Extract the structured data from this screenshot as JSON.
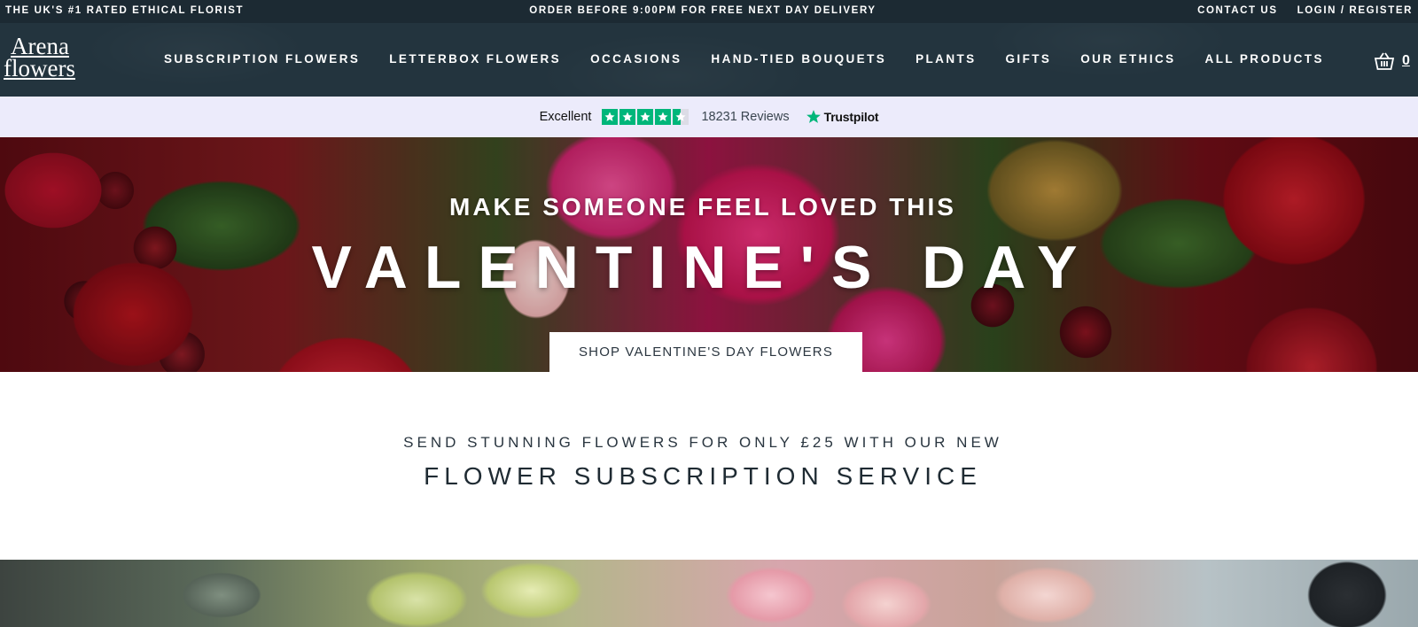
{
  "topbar": {
    "left_text": "THE UK'S #1 RATED ETHICAL FLORIST",
    "center_text": "ORDER BEFORE 9:00PM FOR FREE NEXT DAY DELIVERY",
    "contact_label": "CONTACT US",
    "login_label": "LOGIN / REGISTER"
  },
  "logo": {
    "line1": "Arena",
    "line2": "flowers"
  },
  "nav": {
    "items": [
      {
        "label": "SUBSCRIPTION FLOWERS"
      },
      {
        "label": "LETTERBOX FLOWERS"
      },
      {
        "label": "OCCASIONS"
      },
      {
        "label": "HAND-TIED BOUQUETS"
      },
      {
        "label": "PLANTS"
      },
      {
        "label": "GIFTS"
      },
      {
        "label": "OUR ETHICS"
      },
      {
        "label": "ALL PRODUCTS"
      }
    ],
    "basket_icon": "basket-icon",
    "basket_count": "0"
  },
  "trustpilot": {
    "rating_label": "Excellent",
    "stars": 4.5,
    "reviews_text": "18231 Reviews",
    "brand": "Trustpilot",
    "star_color": "#00b67a"
  },
  "hero": {
    "kicker": "MAKE SOMEONE FEEL LOVED THIS",
    "headline": "VALENTINE'S DAY",
    "cta_label": "SHOP VALENTINE'S DAY FLOWERS"
  },
  "promo": {
    "line1": "SEND STUNNING FLOWERS FOR ONLY £25 WITH OUR NEW",
    "line2": "FLOWER SUBSCRIPTION SERVICE"
  },
  "colors": {
    "topbar_bg": "#1c2a33",
    "nav_bg": "#23343e",
    "trust_bg": "#ecebfb"
  }
}
